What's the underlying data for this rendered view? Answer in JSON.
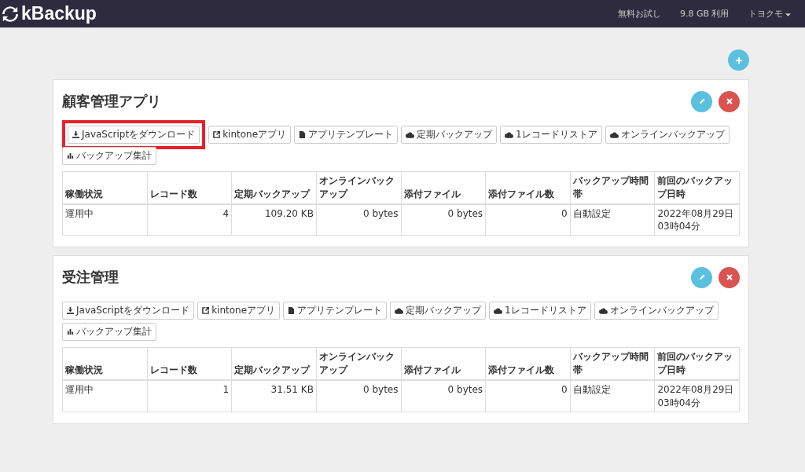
{
  "navbar": {
    "logo": "kBackup",
    "links": [
      "無料お試し",
      "9.8 GB 利用"
    ],
    "user": "トヨクモ"
  },
  "apps": [
    {
      "title": "顧客管理アプリ",
      "buttons": [
        {
          "kind": "download",
          "label": "JavaScriptをダウンロード",
          "highlighted": true
        },
        {
          "kind": "external",
          "label": "kintoneアプリ",
          "highlighted": false
        },
        {
          "kind": "file",
          "label": "アプリテンプレート",
          "highlighted": false
        },
        {
          "kind": "cloud",
          "label": "定期バックアップ",
          "highlighted": false
        },
        {
          "kind": "cloud",
          "label": "1レコードリストア",
          "highlighted": false
        },
        {
          "kind": "cloud",
          "label": "オンラインバックアップ",
          "highlighted": false
        },
        {
          "kind": "chart",
          "label": "バックアップ集計",
          "highlighted": false
        }
      ],
      "columns": [
        "稼働状況",
        "レコード数",
        "定期バックアップ",
        "オンラインバックアップ",
        "添付ファイル",
        "添付ファイル数",
        "バックアップ時間帯",
        "前回のバックアップ日時"
      ],
      "row": [
        "運用中",
        "4",
        "109.20 KB",
        "0 bytes",
        "0 bytes",
        "0",
        "自動設定",
        "2022年08月29日03時04分"
      ]
    },
    {
      "title": "受注管理",
      "buttons": [
        {
          "kind": "download",
          "label": "JavaScriptをダウンロード",
          "highlighted": false
        },
        {
          "kind": "external",
          "label": "kintoneアプリ",
          "highlighted": false
        },
        {
          "kind": "file",
          "label": "アプリテンプレート",
          "highlighted": false
        },
        {
          "kind": "cloud",
          "label": "定期バックアップ",
          "highlighted": false
        },
        {
          "kind": "cloud",
          "label": "1レコードリストア",
          "highlighted": false
        },
        {
          "kind": "cloud",
          "label": "オンラインバックアップ",
          "highlighted": false
        },
        {
          "kind": "chart",
          "label": "バックアップ集計",
          "highlighted": false
        }
      ],
      "columns": [
        "稼働状況",
        "レコード数",
        "定期バックアップ",
        "オンラインバックアップ",
        "添付ファイル",
        "添付ファイル数",
        "バックアップ時間帯",
        "前回のバックアップ日時"
      ],
      "row": [
        "運用中",
        "1",
        "31.51 KB",
        "0 bytes",
        "0 bytes",
        "0",
        "自動設定",
        "2022年08月29日03時04分"
      ]
    }
  ]
}
